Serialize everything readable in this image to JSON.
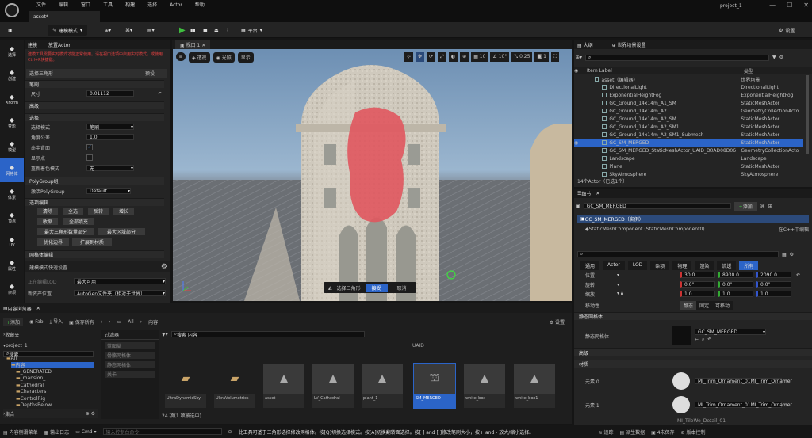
{
  "titlebar": {
    "menu": [
      "文件",
      "编辑",
      "窗口",
      "工具",
      "构建",
      "选择",
      "Actor",
      "帮助"
    ],
    "doc_tab": "asset*",
    "project": "project_1"
  },
  "toolbar": {
    "mode": "建模模式",
    "platform": "平台",
    "settings": "设置"
  },
  "left_panel": {
    "tabs": [
      "建模",
      "放置Actor"
    ],
    "warning": "建模工具需要实时模式才能正常使用。请在视口选项中启用实时模式，或使用Ctrl+R快捷键。",
    "tool_title": "选择三角形",
    "preset": "预设",
    "sections": {
      "brush": "笔刷",
      "advanced": "高级",
      "select": "选择",
      "polygroup": "PolyGroup组",
      "edit": "选项编辑",
      "mesh_edit": "网格体编辑"
    },
    "size_label": "尺寸",
    "size_value": "0.01112",
    "select_mode_label": "选择模式",
    "select_mode_value": "笔刷",
    "angle_label": "角度公差",
    "angle_value": "1.0",
    "hit_back_label": "命中背面",
    "vertex_label": "显示点",
    "override_label": "重新着色模式",
    "override_value": "无",
    "polygroup_label": "激活PolyGroup",
    "polygroup_value": "Default",
    "buttons": [
      "清除",
      "全选",
      "反转",
      "增长",
      "收缩",
      "全部填充",
      "最大三角形数量部分",
      "最大区域部分",
      "优化边界",
      "扩展到材质"
    ],
    "quick_settings": "建模模式快速设置",
    "lod_label": "正在编辑LOD",
    "lod_value": "最大可用",
    "asset_loc_label": "新资产位置",
    "asset_loc_value": "AutoGen文件夹（相对于世界）"
  },
  "mode_bar": [
    {
      "icon": "select-icon",
      "label": "选择"
    },
    {
      "icon": "create-icon",
      "label": "创建"
    },
    {
      "icon": "xform-icon",
      "label": "XForm"
    },
    {
      "icon": "deform-icon",
      "label": "变形"
    },
    {
      "icon": "model-icon",
      "label": "模型"
    },
    {
      "icon": "mesh-icon",
      "label": "网格体"
    },
    {
      "icon": "voxel-icon",
      "label": "体素"
    },
    {
      "icon": "attr-icon",
      "label": "顶点"
    },
    {
      "icon": "uv-icon",
      "label": "UV"
    },
    {
      "icon": "bake-icon",
      "label": "属性"
    },
    {
      "icon": "misc-icon",
      "label": "杂项"
    }
  ],
  "viewport": {
    "tab": "视口 1",
    "buttons": [
      "透视",
      "光照",
      "显示"
    ],
    "grid": "10",
    "rot": "10°",
    "scale": "0.25",
    "cam": "1",
    "action_label": "选择三角形",
    "accept": "接受",
    "cancel": "取消"
  },
  "outliner": {
    "tabs": [
      "大纲",
      "世界场景设置"
    ],
    "col_label": "Item Label",
    "col_type": "类型",
    "rows": [
      {
        "label": "asset（编辑器）",
        "type": "世界场景",
        "indent": 1
      },
      {
        "label": "DirectionalLight",
        "type": "DirectionalLight",
        "indent": 2
      },
      {
        "label": "ExponentialHeightFog",
        "type": "ExponentialHeightFog",
        "indent": 2
      },
      {
        "label": "GC_Ground_14x14m_A1_SM",
        "type": "StaticMeshActor",
        "indent": 2
      },
      {
        "label": "GC_Ground_14x14m_A2",
        "type": "GeometryCollectionActo",
        "indent": 2
      },
      {
        "label": "GC_Ground_14x14m_A2_SM",
        "type": "StaticMeshActor",
        "indent": 2
      },
      {
        "label": "GC_Ground_14x14m_A2_SM1",
        "type": "StaticMeshActor",
        "indent": 2
      },
      {
        "label": "GC_Ground_14x14m_A2_SM1_Submesh",
        "type": "StaticMeshActor",
        "indent": 2
      },
      {
        "label": "GC_SM_MERGED",
        "type": "StaticMeshActor",
        "indent": 2,
        "selected": true
      },
      {
        "label": "GC_SM_MERGED_StaticMeshActor_UAID_D0AD08D06",
        "type": "GeometryCollectionActo",
        "indent": 2
      },
      {
        "label": "Landscape",
        "type": "Landscape",
        "indent": 2
      },
      {
        "label": "Plane",
        "type": "StaticMeshActor",
        "indent": 2
      },
      {
        "label": "SkyAtmosphere",
        "type": "SkyAtmosphere",
        "indent": 2
      }
    ],
    "footer": "14个Actor（已选1个）"
  },
  "details": {
    "tab": "细节",
    "name": "GC_SM_MERGED",
    "add": "添加",
    "instance": "GC_SM_MERGED（实例）",
    "component": "StaticMeshComponent (StaticMeshComponent0)",
    "edit_cpp": "在C++中编辑",
    "filter_tabs": [
      "通用",
      "Actor",
      "LOD",
      "杂项",
      "物理",
      "渲染",
      "流送",
      "所有"
    ],
    "location_label": "位置",
    "location": [
      "30.0",
      "8930.0",
      "2090.0"
    ],
    "rotation_label": "旋转",
    "rotation": [
      "0.0°",
      "0.0°",
      "0.0°"
    ],
    "scale_label": "缩放",
    "scale": [
      "1.0",
      "1.0",
      "1.0"
    ],
    "mobility_label": "移动性",
    "mobility": [
      "静态",
      "固定",
      "可移动"
    ],
    "static_mesh_section": "静态网格体",
    "static_mesh_label": "静态网格体",
    "static_mesh_value": "GC_SM_MERGED",
    "advanced": "高级",
    "materials_section": "材质",
    "element0_label": "元素 0",
    "element0_value": "MI_Trim_Ornament_01",
    "element0_sub": "MI_Trim_Ornamer",
    "element1_label": "元素 1",
    "element1_value": "MI_Trim_Ornament_01",
    "element1_sub": "MI_Trim_Ornamer",
    "element2_value": "MI_TileWe_Detail_01"
  },
  "content_browser": {
    "tab": "内容浏览器",
    "add": "添加",
    "import": "导入",
    "fab": "Fab",
    "save_all": "保存所有",
    "path": [
      "All",
      "内容"
    ],
    "settings": "设置",
    "favorites": "收藏夹",
    "project": "project_1",
    "tree": [
      "All",
      "内容",
      "_GENERATED",
      "_mansion_",
      "Cathedral",
      "Characters",
      "ControlRig",
      "DepthsBelow"
    ],
    "filters_header": "过滤器",
    "filters": [
      "蓝图类",
      "骨骼网格体",
      "静态网格体",
      "关卡"
    ],
    "search_placeholder": "搜索 内容",
    "search_left": "搜索",
    "collections": "集合",
    "count": "24 项(1 项被选中)",
    "items": [
      "UltraDynamicSky",
      "UltraVolumetrics",
      "asset",
      "LV_Cathedral",
      "plant_1",
      "SM_MERGED",
      "white_box",
      "white_box1"
    ],
    "top_item": "UAID_"
  },
  "statusbar": {
    "content_drawer": "内容侧滑菜单",
    "output_log": "输出日志",
    "cmd": "Cmd",
    "cmd_placeholder": "输入控制台命令",
    "hint": "此工具可基于三角形选择修改网格体。按[Q]切换选择模式。按[A]切换翻转面选择。按[ ] and [ ]修改笔刷大小，按+ and - 放大/缩小选择。",
    "trace": "追踪",
    "derived": "派生数据",
    "unsaved": "4未保存",
    "revision": "版本控制"
  }
}
